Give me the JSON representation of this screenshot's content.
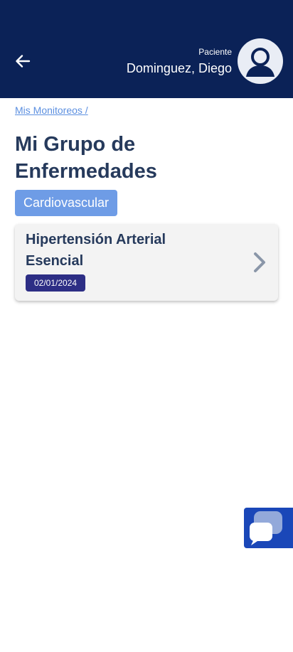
{
  "header": {
    "patient_role": "Paciente",
    "patient_name": "Dominguez, Diego",
    "background_color": "#0b2257"
  },
  "breadcrumb": {
    "label": "Mis Monitoreos /"
  },
  "page": {
    "title": "Mi Grupo de Enfermedades",
    "category": "Cardiovascular"
  },
  "cards": [
    {
      "title": "Hipertensión Arterial Esencial",
      "date": "02/01/2024"
    }
  ],
  "icons": {
    "back": "arrow-left-icon",
    "avatar": "user-icon",
    "card_chevron": "chevron-right-icon",
    "chat": "chat-bubble-icon"
  },
  "colors": {
    "accent": "#6e9ce6",
    "title": "#263a5c",
    "badge": "#2d2e85",
    "chat": "#1a47b8"
  }
}
